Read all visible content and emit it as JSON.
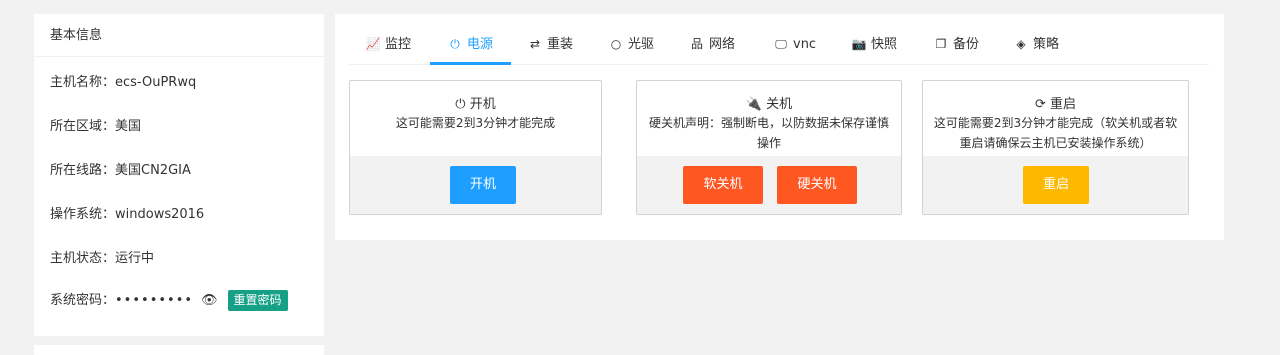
{
  "info": {
    "title": "基本信息",
    "rows": [
      {
        "label": "主机名称：",
        "value": "ecs-OuPRwq"
      },
      {
        "label": "所在区域：",
        "value": "美国"
      },
      {
        "label": "所在线路：",
        "value": "美国CN2GIA"
      },
      {
        "label": "操作系统：",
        "value": "windows2016"
      },
      {
        "label": "主机状态：",
        "value": "运行中"
      }
    ],
    "password": {
      "label": "系统密码：",
      "value": "•••••••••",
      "reset_label": "重置密码",
      "eye_icon": "👁"
    }
  },
  "tabs": [
    {
      "icon": "📈",
      "icon_name": "chart-line-icon",
      "label": "监控"
    },
    {
      "icon": "⏻",
      "icon_name": "power-icon",
      "label": "电源",
      "active": true
    },
    {
      "icon": "⇄",
      "icon_name": "retweet-icon",
      "label": "重装"
    },
    {
      "icon": "○",
      "icon_name": "disc-icon",
      "label": "光驱"
    },
    {
      "icon": "品",
      "icon_name": "sitemap-icon",
      "label": "网络"
    },
    {
      "icon": "🖵",
      "icon_name": "monitor-icon",
      "label": "vnc"
    },
    {
      "icon": "📷",
      "icon_name": "camera-icon",
      "label": "快照"
    },
    {
      "icon": "❐",
      "icon_name": "copy-icon",
      "label": "备份"
    },
    {
      "icon": "◈",
      "icon_name": "shield-icon",
      "label": "策略"
    }
  ],
  "panels": {
    "poweron": {
      "icon": "⏻",
      "title": "开机",
      "desc": "这可能需要2到3分钟才能完成",
      "button": "开机"
    },
    "poweroff": {
      "icon": "🔌",
      "title": "关机",
      "desc": "硬关机声明：强制断电，以防数据未保存谨慎操作",
      "soft_button": "软关机",
      "hard_button": "硬关机"
    },
    "reboot": {
      "icon": "⟳",
      "title": "重启",
      "desc": "这可能需要2到3分钟才能完成（软关机或者软重启请确保云主机已安装操作系统）",
      "button": "重启"
    }
  },
  "colors": {
    "accent": "#1e9fff",
    "danger": "#ff5722",
    "warning": "#ffb800",
    "reset": "#16a085"
  }
}
